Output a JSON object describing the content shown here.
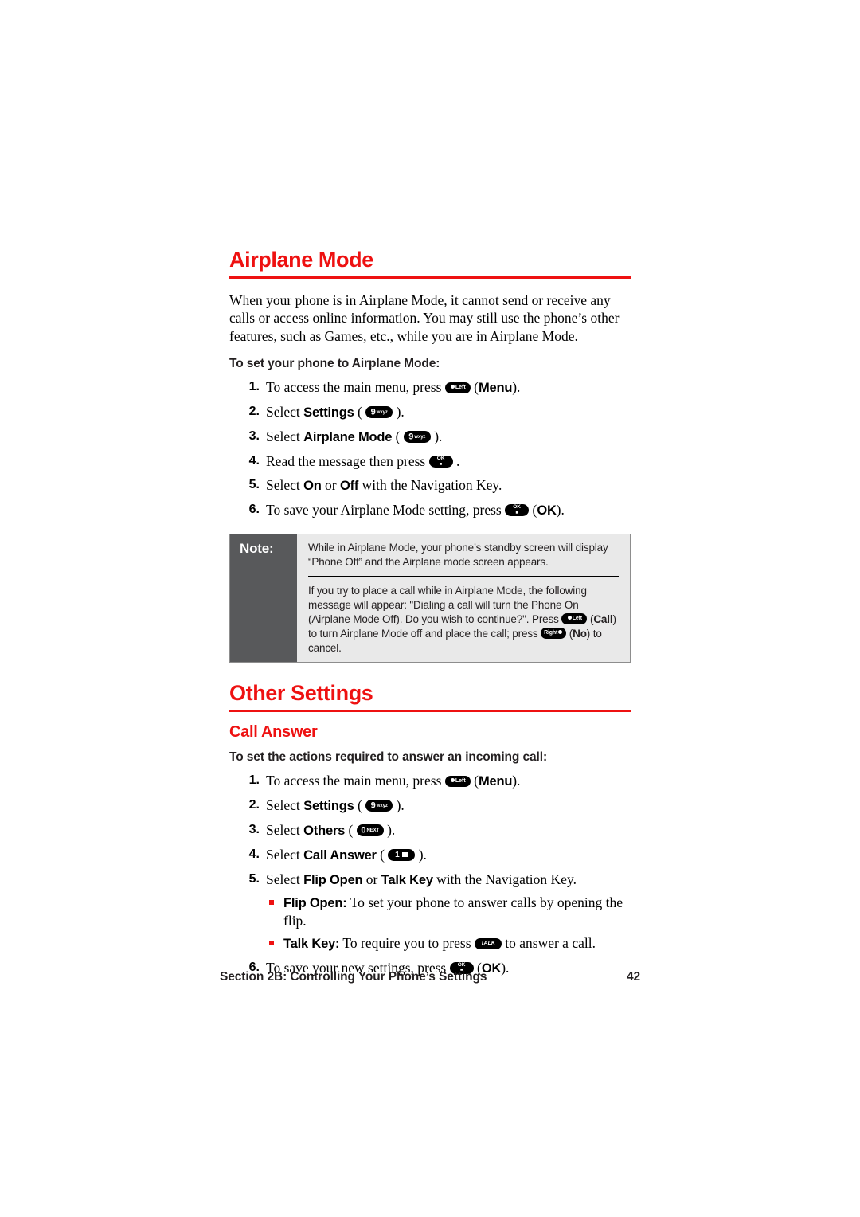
{
  "document": {
    "page_number": "42",
    "footer_section": "Section 2B: Controlling Your Phone’s Settings"
  },
  "airplane_section": {
    "title": "Airplane Mode",
    "intro": "When your phone is in Airplane Mode, it cannot send or receive any calls or access online information. You may still use the phone’s other features, such as Games, etc., while you are in Airplane Mode.",
    "lead_in": "To set your phone to Airplane Mode:",
    "steps": [
      {
        "num": "1.",
        "pre": "To access the main menu, press ",
        "key": "left-soft",
        "key_label": "Left",
        "post": " (",
        "bold": "Menu",
        "tail": ")."
      },
      {
        "num": "2.",
        "pre": "Select ",
        "bold": "Settings",
        "mid": " ( ",
        "key": "num-9",
        "key_big": "9",
        "key_small": "wxyz",
        "tail": " )."
      },
      {
        "num": "3.",
        "pre": "Select ",
        "bold": "Airplane Mode",
        "mid": " ( ",
        "key": "num-9",
        "key_big": "9",
        "key_small": "wxyz",
        "tail": " )."
      },
      {
        "num": "4.",
        "pre": "Read the message then press ",
        "key": "ok",
        "key_l1": "OK",
        "key_l2": "■",
        "tail": " ."
      },
      {
        "num": "5.",
        "pre": "Select ",
        "bold": "On",
        "mid": " or ",
        "bold2": "Off",
        "tail": " with the Navigation Key."
      },
      {
        "num": "6.",
        "pre": "To save your Airplane Mode setting, press ",
        "key": "ok",
        "key_l1": "OK",
        "key_l2": "■",
        "post": " (",
        "bold": "OK",
        "tail": ")."
      }
    ],
    "note": {
      "label": "Note:",
      "paragraph_1": "While in Airplane Mode, your phone’s standby screen will display “Phone Off” and the Airplane mode screen appears.",
      "paragraph_2_a": "If you try to place a call while in Airplane Mode, the following message will appear: \"Dialing a call will turn the Phone On (Airplane Mode Off). Do you wish to continue?\".  Press ",
      "paragraph_2_key_left": "Left",
      "paragraph_2_b": " (",
      "paragraph_2_bold_call": "Call",
      "paragraph_2_c": ") to turn Airplane Mode off and place the call; press ",
      "paragraph_2_key_right": "Right",
      "paragraph_2_d": " (",
      "paragraph_2_bold_no": "No",
      "paragraph_2_e": ") to cancel."
    }
  },
  "other_settings_section": {
    "title": "Other Settings",
    "subtitle": "Call Answer",
    "lead_in": "To set the actions required to answer an incoming call:",
    "steps": [
      {
        "num": "1.",
        "pre": "To access the main menu, press ",
        "key": "left-soft",
        "key_label": "Left",
        "post": " (",
        "bold": "Menu",
        "tail": ")."
      },
      {
        "num": "2.",
        "pre": "Select ",
        "bold": "Settings",
        "mid": " ( ",
        "key": "num-9",
        "key_big": "9",
        "key_small": "wxyz",
        "tail": " )."
      },
      {
        "num": "3.",
        "pre": "Select ",
        "bold": "Others",
        "mid": " ( ",
        "key": "num-0",
        "key_big": "0",
        "key_small": "NEXT",
        "tail": " )."
      },
      {
        "num": "4.",
        "pre": "Select ",
        "bold": "Call Answer",
        "mid": " ( ",
        "key": "num-1-voicemail",
        "key_big": "1",
        "tail": " )."
      },
      {
        "num": "5.",
        "pre": "Select ",
        "bold": "Flip Open",
        "mid": " or ",
        "bold2": "Talk Key",
        "tail": " with the Navigation Key."
      }
    ],
    "bullets": [
      {
        "bold": "Flip Open:",
        "text": " To set your phone to answer calls by opening the flip."
      },
      {
        "bold": "Talk Key:",
        "text_pre": " To require you to press ",
        "key": "talk",
        "key_label": "TALK",
        "text_post": " to answer a call."
      }
    ],
    "final_step": {
      "num": "6.",
      "pre": "To save your new settings, press ",
      "key": "ok",
      "key_l1": "OK",
      "key_l2": "■",
      "post": " (",
      "bold": "OK",
      "tail": ")."
    }
  },
  "colors": {
    "heading_red": "#ee1111",
    "note_label_bg": "#58595b",
    "note_body_bg": "#e9e9e9",
    "bullet_red": "#ee1111"
  }
}
